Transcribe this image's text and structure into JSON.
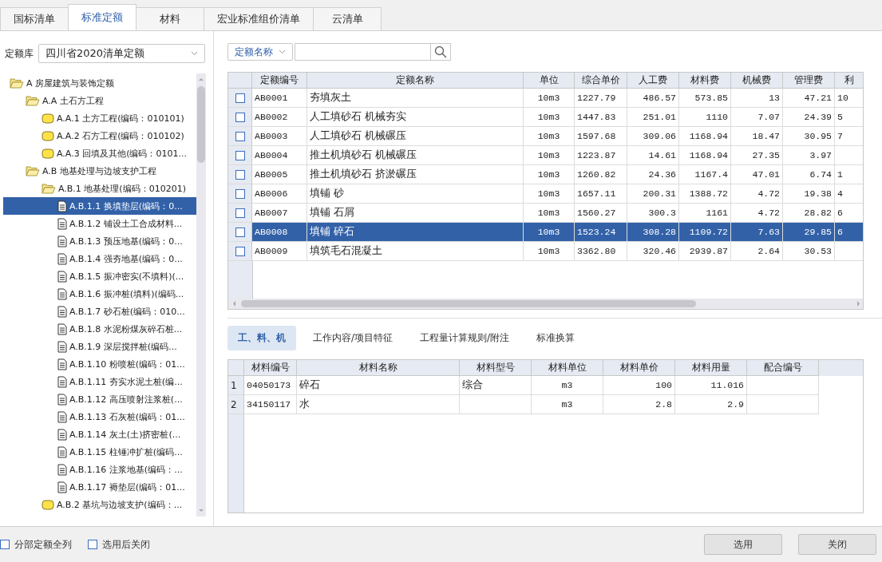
{
  "tabs": [
    {
      "label": "国标清单",
      "selected": false
    },
    {
      "label": "标准定额",
      "selected": true
    },
    {
      "label": "材料",
      "selected": false
    },
    {
      "label": "宏业标准组价清单",
      "selected": false
    },
    {
      "label": "云清单",
      "selected": false
    }
  ],
  "library": {
    "label": "定额库",
    "value": "四川省2020清单定额"
  },
  "tree": [
    {
      "label": "A 房屋建筑与装饰定额",
      "kind": "folder",
      "expanded": true,
      "selected": false,
      "children": [
        {
          "label": "A.A 土石方工程",
          "kind": "folder",
          "expanded": true,
          "selected": false,
          "children": [
            {
              "label": "A.A.1 土方工程(编码：010101)",
              "kind": "folder",
              "expanded": false,
              "selected": false
            },
            {
              "label": "A.A.2 石方工程(编码：010102)",
              "kind": "folder",
              "expanded": false,
              "selected": false
            },
            {
              "label": "A.A.3 回填及其他(编码：0101...",
              "kind": "folder",
              "expanded": false,
              "selected": false
            }
          ]
        },
        {
          "label": "A.B 地基处理与边坡支护工程",
          "kind": "folder",
          "expanded": true,
          "selected": false,
          "children": [
            {
              "label": "A.B.1 地基处理(编码：010201)",
              "kind": "folder",
              "expanded": true,
              "selected": false,
              "children": [
                {
                  "label": "A.B.1.1 换填垫层(编码：0...",
                  "kind": "item",
                  "selected": true
                },
                {
                  "label": "A.B.1.2 铺设土工合成材料...",
                  "kind": "item",
                  "selected": false
                },
                {
                  "label": "A.B.1.3 预压地基(编码：0...",
                  "kind": "item",
                  "selected": false
                },
                {
                  "label": "A.B.1.4 强夯地基(编码：0...",
                  "kind": "item",
                  "selected": false
                },
                {
                  "label": "A.B.1.5 振冲密实(不填料)(...",
                  "kind": "item",
                  "selected": false
                },
                {
                  "label": "A.B.1.6 振冲桩(填料)(编码...",
                  "kind": "item",
                  "selected": false
                },
                {
                  "label": "A.B.1.7 砂石桩(编码：010...",
                  "kind": "item",
                  "selected": false
                },
                {
                  "label": "A.B.1.8 水泥粉煤灰碎石桩...",
                  "kind": "item",
                  "selected": false
                },
                {
                  "label": "A.B.1.9 深层搅拌桩(编码...",
                  "kind": "item",
                  "selected": false
                },
                {
                  "label": "A.B.1.10 粉喷桩(编码：01...",
                  "kind": "item",
                  "selected": false
                },
                {
                  "label": "A.B.1.11 夯实水泥土桩(编...",
                  "kind": "item",
                  "selected": false
                },
                {
                  "label": "A.B.1.12 高压喷射注浆桩(...",
                  "kind": "item",
                  "selected": false
                },
                {
                  "label": "A.B.1.13 石灰桩(编码：01...",
                  "kind": "item",
                  "selected": false
                },
                {
                  "label": "A.B.1.14 灰土(土)挤密桩(...",
                  "kind": "item",
                  "selected": false
                },
                {
                  "label": "A.B.1.15 柱锤冲扩桩(编码...",
                  "kind": "item",
                  "selected": false
                },
                {
                  "label": "A.B.1.16 注浆地基(编码：...",
                  "kind": "item",
                  "selected": false
                },
                {
                  "label": "A.B.1.17 褥垫层(编码：01...",
                  "kind": "item",
                  "selected": false
                }
              ]
            },
            {
              "label": "A.B.2 基坑与边坡支护(编码：...",
              "kind": "folder",
              "expanded": false,
              "selected": false
            }
          ]
        }
      ]
    }
  ],
  "search": {
    "field": "定额名称"
  },
  "quota_table": {
    "columns": [
      "定额编号",
      "定额名称",
      "单位",
      "综合单价",
      "人工费",
      "材料费",
      "机械费",
      "管理费",
      "利"
    ],
    "rows": [
      {
        "checked": false,
        "selected": false,
        "cells": [
          "AB0001",
          "夯填灰土",
          "10m3",
          "1227.79",
          "486.57",
          "573.85",
          "13",
          "47.21",
          "10"
        ]
      },
      {
        "checked": false,
        "selected": false,
        "cells": [
          "AB0002",
          "人工填砂石 机械夯实",
          "10m3",
          "1447.83",
          "251.01",
          "1110",
          "7.07",
          "24.39",
          "5"
        ]
      },
      {
        "checked": false,
        "selected": false,
        "cells": [
          "AB0003",
          "人工填砂石 机械碾压",
          "10m3",
          "1597.68",
          "309.06",
          "1168.94",
          "18.47",
          "30.95",
          "7"
        ]
      },
      {
        "checked": false,
        "selected": false,
        "cells": [
          "AB0004",
          "推土机填砂石 机械碾压",
          "10m3",
          "1223.87",
          "14.61",
          "1168.94",
          "27.35",
          "3.97",
          ""
        ]
      },
      {
        "checked": false,
        "selected": false,
        "cells": [
          "AB0005",
          "推土机填砂石 挤淤碾压",
          "10m3",
          "1260.82",
          "24.36",
          "1167.4",
          "47.01",
          "6.74",
          "1"
        ]
      },
      {
        "checked": false,
        "selected": false,
        "cells": [
          "AB0006",
          "填铺 砂",
          "10m3",
          "1657.11",
          "200.31",
          "1388.72",
          "4.72",
          "19.38",
          "4"
        ]
      },
      {
        "checked": false,
        "selected": false,
        "cells": [
          "AB0007",
          "填铺 石屑",
          "10m3",
          "1560.27",
          "300.3",
          "1161",
          "4.72",
          "28.82",
          "6"
        ]
      },
      {
        "checked": false,
        "selected": true,
        "cells": [
          "AB0008",
          "填铺 碎石",
          "10m3",
          "1523.24",
          "308.28",
          "1109.72",
          "7.63",
          "29.85",
          "6"
        ]
      },
      {
        "checked": false,
        "selected": false,
        "cells": [
          "AB0009",
          "填筑毛石混凝土",
          "10m3",
          "3362.80",
          "320.46",
          "2939.87",
          "2.64",
          "30.53",
          ""
        ]
      }
    ]
  },
  "detail_tabs": [
    {
      "label": "工、料、机",
      "selected": true
    },
    {
      "label": "工作内容/项目特征",
      "selected": false
    },
    {
      "label": "工程量计算规则/附注",
      "selected": false
    },
    {
      "label": "标准换算",
      "selected": false
    }
  ],
  "material_table": {
    "columns": [
      "材料编号",
      "材料名称",
      "材料型号",
      "材料单位",
      "材料单价",
      "材料用量",
      "配合编号"
    ],
    "rows": [
      {
        "index": "1",
        "cells": [
          "04050173",
          "碎石",
          "综合",
          "m3",
          "100",
          "11.016",
          ""
        ]
      },
      {
        "index": "2",
        "cells": [
          "34150117",
          "水",
          "",
          "m3",
          "2.8",
          "2.9",
          ""
        ]
      }
    ]
  },
  "options": [
    {
      "label": "分部定额全列",
      "checked": false
    },
    {
      "label": "选用后关闭",
      "checked": false
    }
  ],
  "buttons": [
    "选用",
    "关闭"
  ]
}
